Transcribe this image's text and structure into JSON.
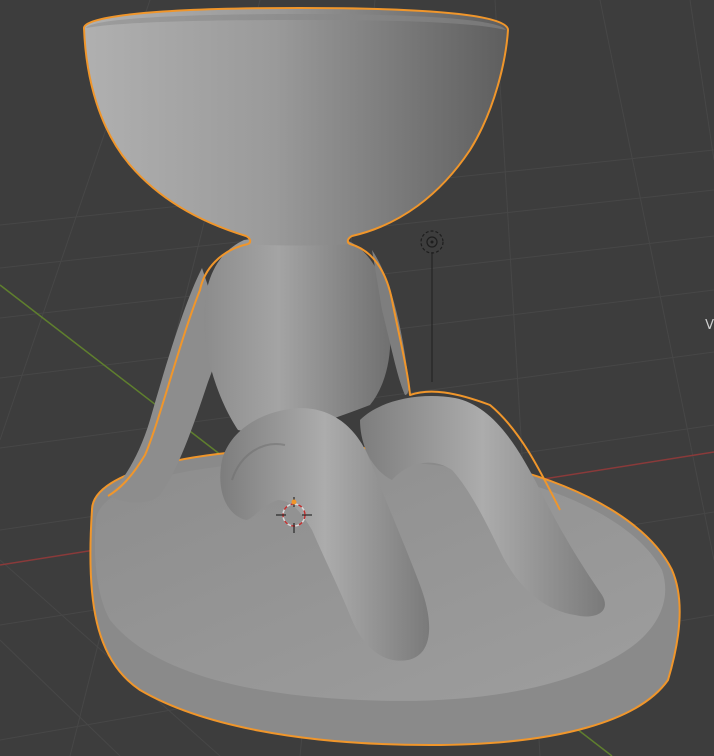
{
  "viewport": {
    "mode": "Object Mode",
    "selected_object": "planter-figure",
    "edge_glyph": "V"
  },
  "colors": {
    "background": "#3d3d3d",
    "grid": "#474747",
    "x_axis": "#8a3a3a",
    "y_axis": "#5f7f2e",
    "selection_outline": "#f0962b",
    "mesh": "#8e8e8e"
  },
  "icons": [
    "3d-cursor-icon",
    "light-object-icon"
  ]
}
